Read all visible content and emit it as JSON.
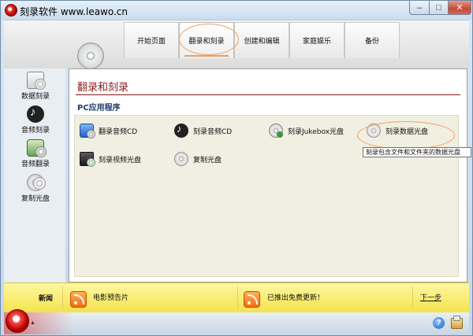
{
  "window": {
    "title": "刻录软件 www.leawo.cn",
    "minimize_glyph": "–",
    "maximize_glyph": "□",
    "close_glyph": "✕"
  },
  "tabs": [
    {
      "label": "开始页面",
      "active": false
    },
    {
      "label": "翻录和刻录",
      "active": true
    },
    {
      "label": "创建和编辑",
      "active": false
    },
    {
      "label": "家庭娱乐",
      "active": false
    },
    {
      "label": "备份",
      "active": false
    }
  ],
  "sidebar": {
    "items": [
      {
        "label": "数据刻录",
        "icon": "data-disc-icon"
      },
      {
        "label": "音频刻录",
        "icon": "music-note-icon"
      },
      {
        "label": "音频翻录",
        "icon": "rip-icon"
      },
      {
        "label": "复制光盘",
        "icon": "copy-disc-icon"
      }
    ]
  },
  "main": {
    "title": "翻录和刻录",
    "section_title": "PC应用程序",
    "tasks": [
      {
        "label": "翻录音频CD",
        "icon": "audio-cd-rip-icon"
      },
      {
        "label": "刻录音频CD",
        "icon": "music-note-icon"
      },
      {
        "label": "刻录Jukebox光盘",
        "icon": "jukebox-disc-icon"
      },
      {
        "label": "刻录数据光盘",
        "icon": "data-disc-icon"
      },
      {
        "label": "刻录视频光盘",
        "icon": "video-disc-icon"
      },
      {
        "label": "复制光盘",
        "icon": "copy-disc-icon"
      }
    ],
    "tooltip": "刻录包含文件和文件夹的数据光盘"
  },
  "newsbar": {
    "label": "新闻",
    "items": [
      "电影预告片",
      "已推出免费更新！"
    ],
    "next_link": "下一步"
  },
  "bottombar": {
    "help_glyph": "?",
    "logo_arrow": "▲"
  },
  "colors": {
    "title_red": "#8b1a1a",
    "section_blue": "#1f3f6a",
    "highlight_orange": "#f0a060",
    "newsbar_yellow": "#f4e34d",
    "content_beige": "#f1efe1"
  }
}
